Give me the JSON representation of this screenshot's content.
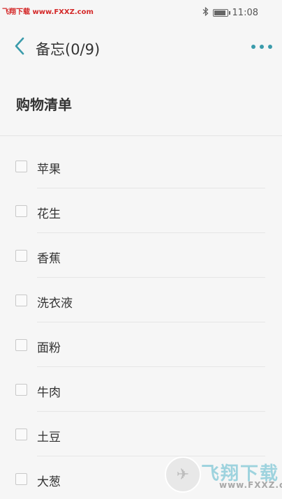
{
  "status_bar": {
    "watermark": "飞翔下载 www.FXXZ.com",
    "time": "11:08"
  },
  "header": {
    "title": "备忘(0/9)",
    "back_icon": "chevron-left-icon",
    "more_icon": "more-dots-icon",
    "accent_color": "#3a9bab"
  },
  "note": {
    "title": "购物清单"
  },
  "checklist": {
    "items": [
      {
        "label": "苹果",
        "checked": false
      },
      {
        "label": "花生",
        "checked": false
      },
      {
        "label": "香蕉",
        "checked": false
      },
      {
        "label": "洗衣液",
        "checked": false
      },
      {
        "label": "面粉",
        "checked": false
      },
      {
        "label": "牛肉",
        "checked": false
      },
      {
        "label": "土豆",
        "checked": false
      },
      {
        "label": "大葱",
        "checked": false
      }
    ]
  },
  "watermark_badge": {
    "big_text": "飞翔下载",
    "small_text": "www.FXXZ.com"
  }
}
